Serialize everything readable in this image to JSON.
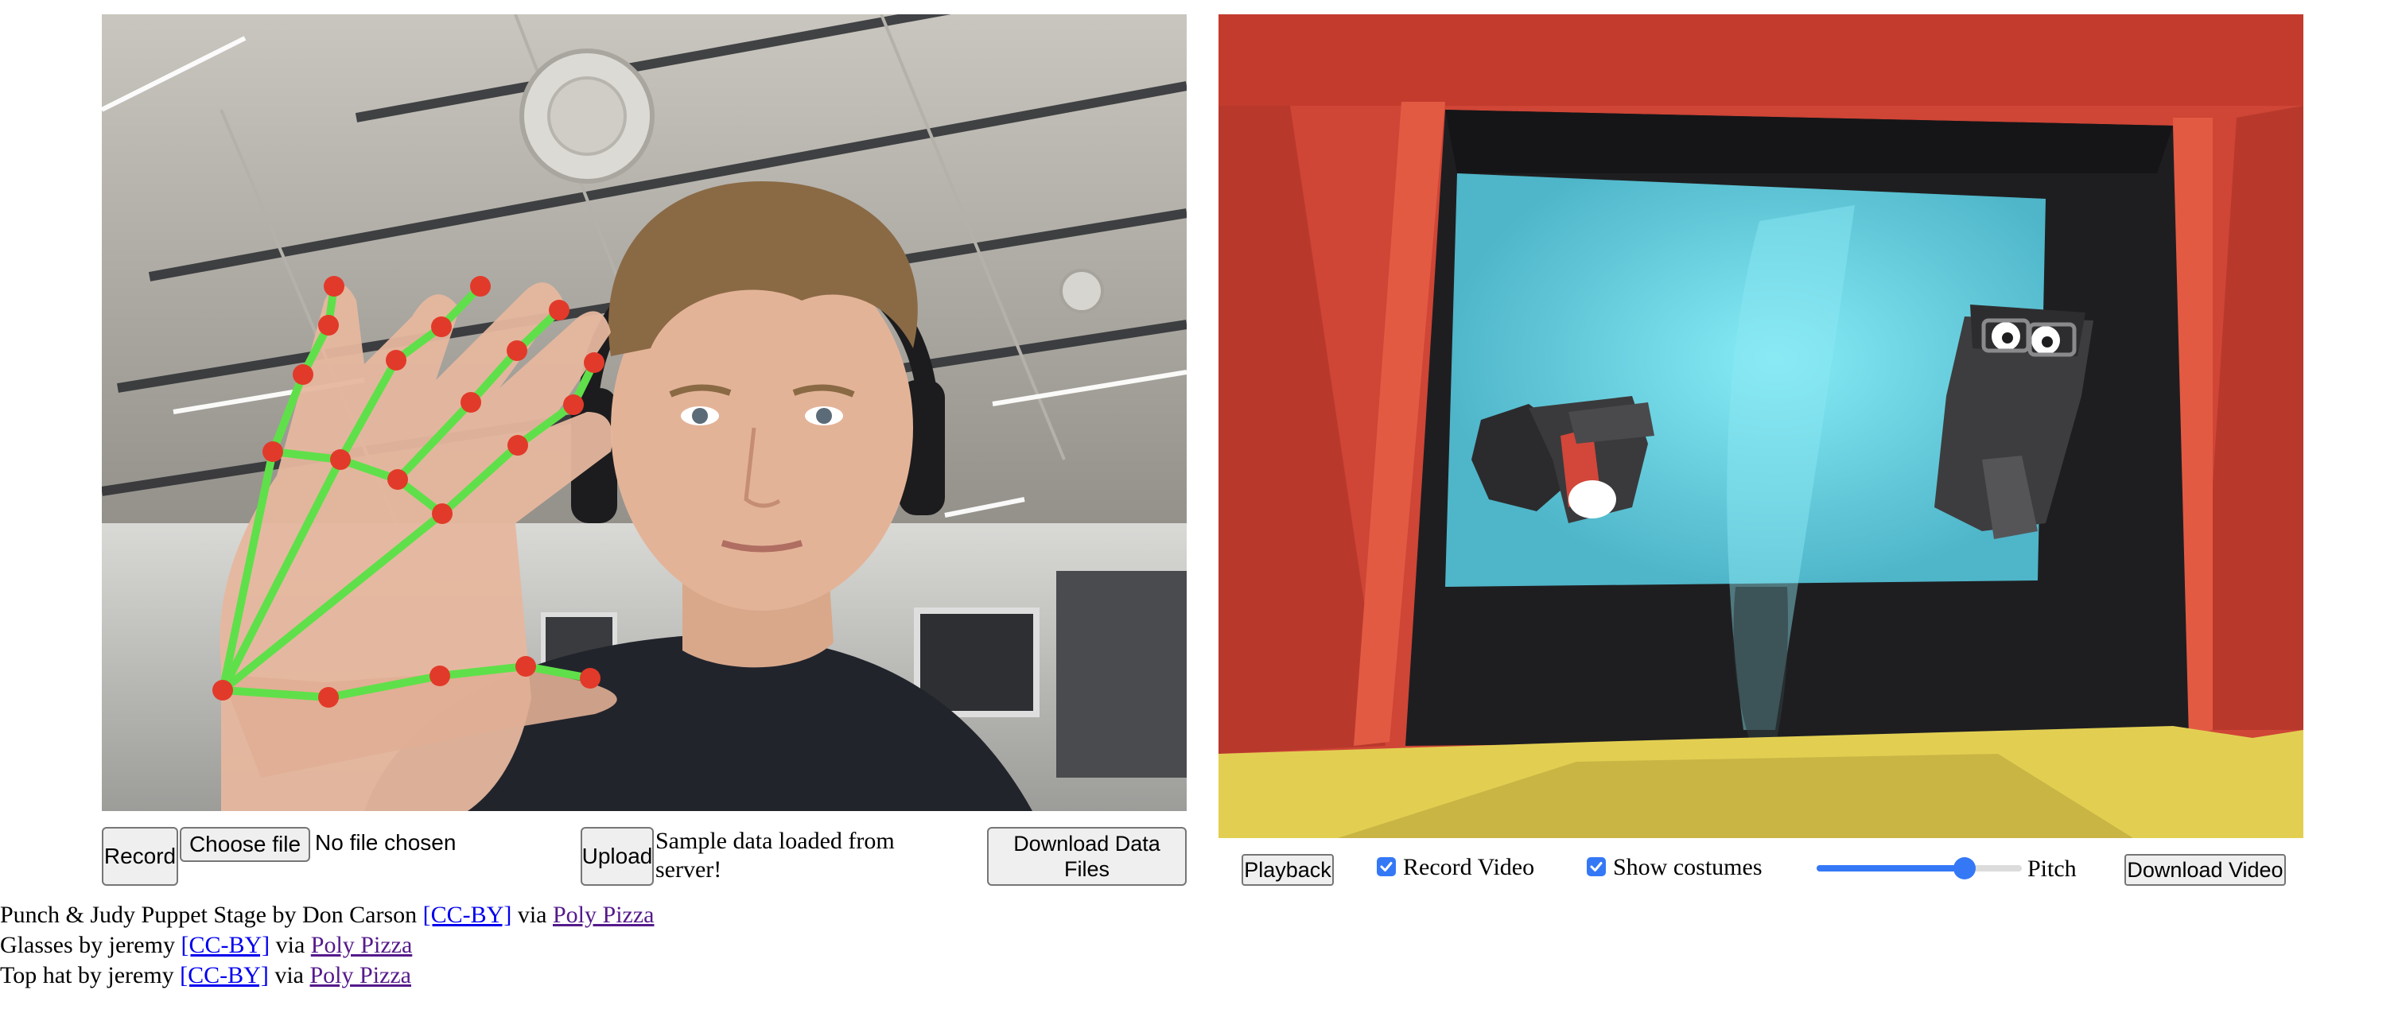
{
  "left_controls": {
    "record_label": "Record",
    "choose_file_label": "Choose file",
    "file_status": "No file chosen",
    "upload_label": "Upload",
    "sample_status": "Sample data loaded from server!",
    "download_data_label": "Download Data Files"
  },
  "right_controls": {
    "playback_label": "Playback",
    "record_video_label": "Record Video",
    "record_video_checked": true,
    "show_costumes_label": "Show costumes",
    "show_costumes_checked": true,
    "pitch_label": "Pitch",
    "pitch_level_fraction": 0.72,
    "download_video_label": "Download Video"
  },
  "credits": [
    {
      "text": "Punch & Judy Puppet Stage by Don Carson",
      "license": "[CC-BY]",
      "via": "via",
      "source": "Poly Pizza"
    },
    {
      "text": "Glasses by jeremy",
      "license": "[CC-BY]",
      "via": "via",
      "source": "Poly Pizza"
    },
    {
      "text": "Top hat by jeremy",
      "license": "[CC-BY]",
      "via": "via",
      "source": "Poly Pizza"
    }
  ],
  "colors": {
    "accent": "#3478f6",
    "link": "#0000ee",
    "link_visited": "#551a8b",
    "hand_line": "#5fe04a",
    "hand_joint": "#e23a2a",
    "stage_red": "#cf4536",
    "stage_floor": "#e2cf52",
    "stage_backdrop": "#57c4d8"
  }
}
